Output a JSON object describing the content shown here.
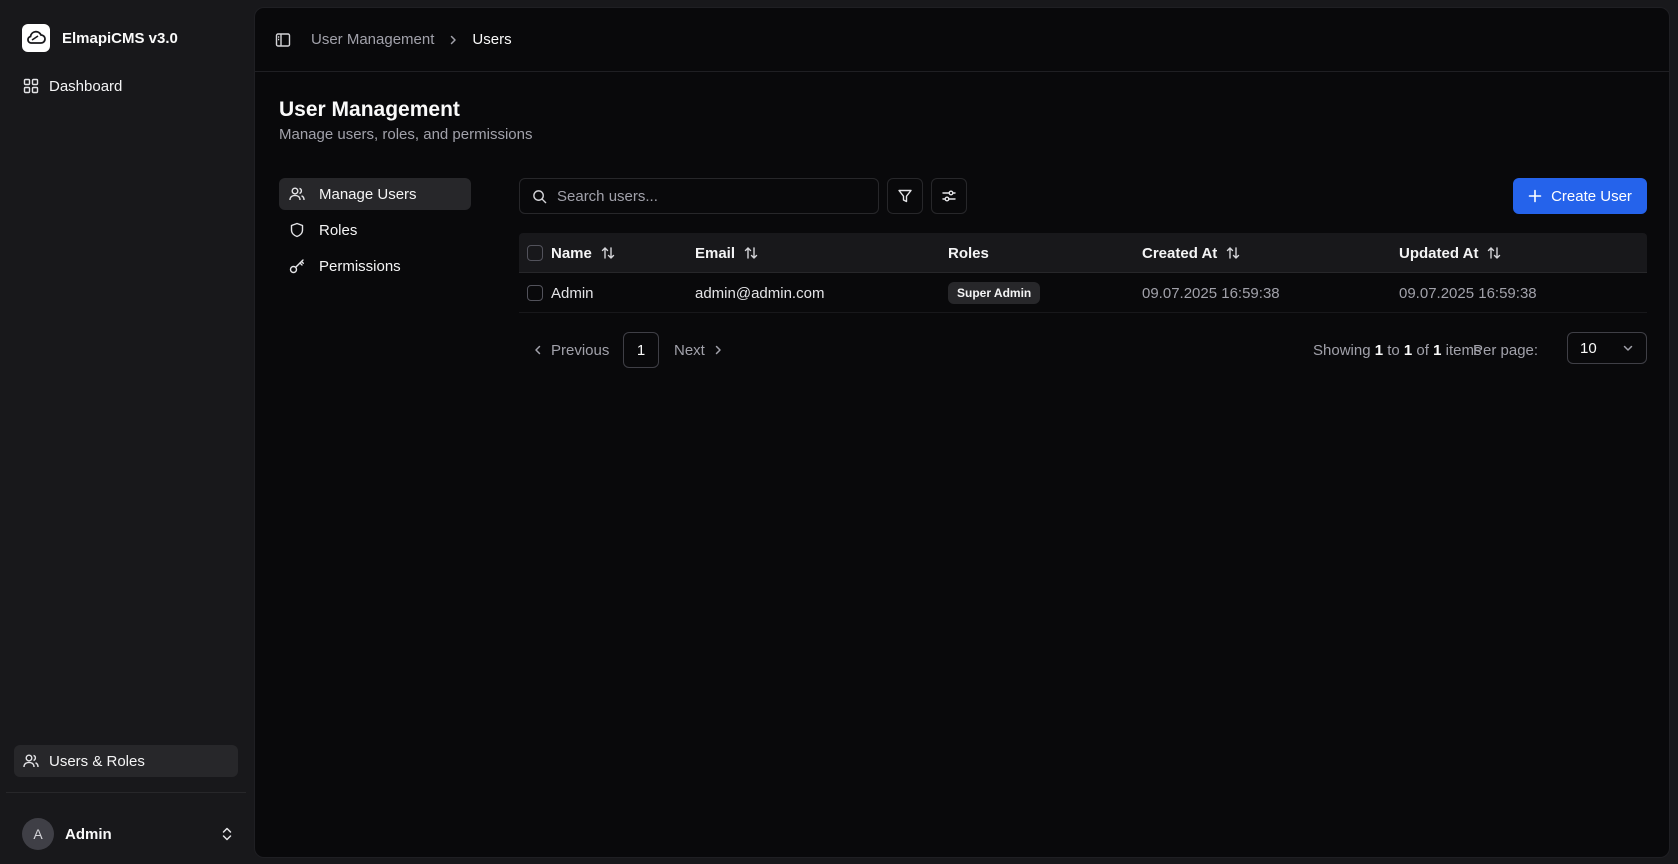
{
  "app": {
    "name": "ElmapiCMS v3.0"
  },
  "sidebar": {
    "top_items": [
      {
        "label": "Dashboard",
        "icon": "dashboard-icon"
      }
    ],
    "bottom_items": [
      {
        "label": "Users & Roles",
        "icon": "users-icon",
        "active": true
      }
    ],
    "user": {
      "initial": "A",
      "name": "Admin"
    }
  },
  "breadcrumb": {
    "parent": "User Management",
    "current": "Users"
  },
  "page": {
    "title": "User Management",
    "subtitle": "Manage users, roles, and permissions"
  },
  "sub_nav": [
    {
      "label": "Manage Users",
      "icon": "users-icon",
      "active": true
    },
    {
      "label": "Roles",
      "icon": "shield-icon",
      "active": false
    },
    {
      "label": "Permissions",
      "icon": "key-icon",
      "active": false
    }
  ],
  "toolbar": {
    "search_placeholder": "Search users...",
    "search_value": "",
    "create_label": "Create User"
  },
  "table": {
    "columns": [
      "Name",
      "Email",
      "Roles",
      "Created At",
      "Updated At"
    ],
    "rows": [
      {
        "name": "Admin",
        "email": "admin@admin.com",
        "role": "Super Admin",
        "created_at": "09.07.2025 16:59:38",
        "updated_at": "09.07.2025 16:59:38"
      }
    ]
  },
  "pagination": {
    "prev_label": "Previous",
    "next_label": "Next",
    "current_page": "1",
    "showing_prefix": "Showing ",
    "from": "1",
    "to_word": " to ",
    "to": "1",
    "of_word": " of ",
    "total": "1",
    "items_word": " items",
    "per_page_label": "Per page:",
    "per_page_value": "10"
  },
  "colors": {
    "accent": "#2563eb",
    "background": "#09090b",
    "sidebar": "#18181b",
    "active_item": "#27272a"
  }
}
